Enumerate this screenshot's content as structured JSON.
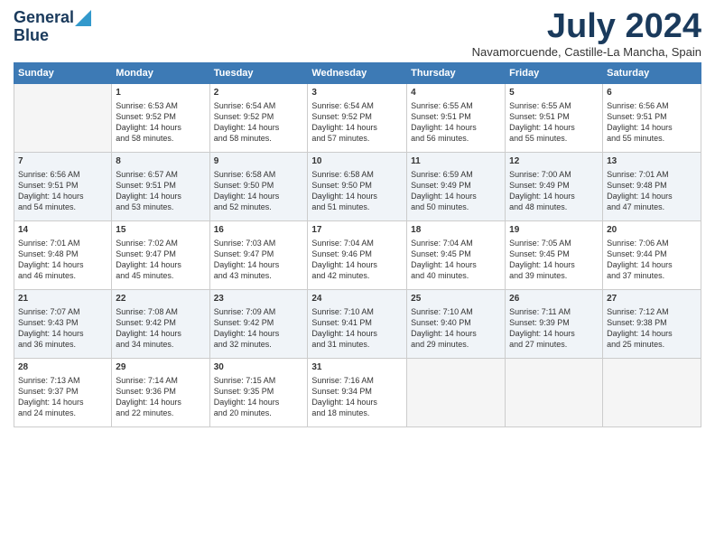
{
  "header": {
    "logo_general": "General",
    "logo_blue": "Blue",
    "month_title": "July 2024",
    "subtitle": "Navamorcuende, Castille-La Mancha, Spain"
  },
  "weekdays": [
    "Sunday",
    "Monday",
    "Tuesday",
    "Wednesday",
    "Thursday",
    "Friday",
    "Saturday"
  ],
  "weeks": [
    [
      {
        "day": null
      },
      {
        "day": 1,
        "sunrise": "6:53 AM",
        "sunset": "9:52 PM",
        "daylight": "14 hours and 58 minutes."
      },
      {
        "day": 2,
        "sunrise": "6:54 AM",
        "sunset": "9:52 PM",
        "daylight": "14 hours and 58 minutes."
      },
      {
        "day": 3,
        "sunrise": "6:54 AM",
        "sunset": "9:52 PM",
        "daylight": "14 hours and 57 minutes."
      },
      {
        "day": 4,
        "sunrise": "6:55 AM",
        "sunset": "9:51 PM",
        "daylight": "14 hours and 56 minutes."
      },
      {
        "day": 5,
        "sunrise": "6:55 AM",
        "sunset": "9:51 PM",
        "daylight": "14 hours and 55 minutes."
      },
      {
        "day": 6,
        "sunrise": "6:56 AM",
        "sunset": "9:51 PM",
        "daylight": "14 hours and 55 minutes."
      }
    ],
    [
      {
        "day": 7,
        "sunrise": "6:56 AM",
        "sunset": "9:51 PM",
        "daylight": "14 hours and 54 minutes."
      },
      {
        "day": 8,
        "sunrise": "6:57 AM",
        "sunset": "9:51 PM",
        "daylight": "14 hours and 53 minutes."
      },
      {
        "day": 9,
        "sunrise": "6:58 AM",
        "sunset": "9:50 PM",
        "daylight": "14 hours and 52 minutes."
      },
      {
        "day": 10,
        "sunrise": "6:58 AM",
        "sunset": "9:50 PM",
        "daylight": "14 hours and 51 minutes."
      },
      {
        "day": 11,
        "sunrise": "6:59 AM",
        "sunset": "9:49 PM",
        "daylight": "14 hours and 50 minutes."
      },
      {
        "day": 12,
        "sunrise": "7:00 AM",
        "sunset": "9:49 PM",
        "daylight": "14 hours and 48 minutes."
      },
      {
        "day": 13,
        "sunrise": "7:01 AM",
        "sunset": "9:48 PM",
        "daylight": "14 hours and 47 minutes."
      }
    ],
    [
      {
        "day": 14,
        "sunrise": "7:01 AM",
        "sunset": "9:48 PM",
        "daylight": "14 hours and 46 minutes."
      },
      {
        "day": 15,
        "sunrise": "7:02 AM",
        "sunset": "9:47 PM",
        "daylight": "14 hours and 45 minutes."
      },
      {
        "day": 16,
        "sunrise": "7:03 AM",
        "sunset": "9:47 PM",
        "daylight": "14 hours and 43 minutes."
      },
      {
        "day": 17,
        "sunrise": "7:04 AM",
        "sunset": "9:46 PM",
        "daylight": "14 hours and 42 minutes."
      },
      {
        "day": 18,
        "sunrise": "7:04 AM",
        "sunset": "9:45 PM",
        "daylight": "14 hours and 40 minutes."
      },
      {
        "day": 19,
        "sunrise": "7:05 AM",
        "sunset": "9:45 PM",
        "daylight": "14 hours and 39 minutes."
      },
      {
        "day": 20,
        "sunrise": "7:06 AM",
        "sunset": "9:44 PM",
        "daylight": "14 hours and 37 minutes."
      }
    ],
    [
      {
        "day": 21,
        "sunrise": "7:07 AM",
        "sunset": "9:43 PM",
        "daylight": "14 hours and 36 minutes."
      },
      {
        "day": 22,
        "sunrise": "7:08 AM",
        "sunset": "9:42 PM",
        "daylight": "14 hours and 34 minutes."
      },
      {
        "day": 23,
        "sunrise": "7:09 AM",
        "sunset": "9:42 PM",
        "daylight": "14 hours and 32 minutes."
      },
      {
        "day": 24,
        "sunrise": "7:10 AM",
        "sunset": "9:41 PM",
        "daylight": "14 hours and 31 minutes."
      },
      {
        "day": 25,
        "sunrise": "7:10 AM",
        "sunset": "9:40 PM",
        "daylight": "14 hours and 29 minutes."
      },
      {
        "day": 26,
        "sunrise": "7:11 AM",
        "sunset": "9:39 PM",
        "daylight": "14 hours and 27 minutes."
      },
      {
        "day": 27,
        "sunrise": "7:12 AM",
        "sunset": "9:38 PM",
        "daylight": "14 hours and 25 minutes."
      }
    ],
    [
      {
        "day": 28,
        "sunrise": "7:13 AM",
        "sunset": "9:37 PM",
        "daylight": "14 hours and 24 minutes."
      },
      {
        "day": 29,
        "sunrise": "7:14 AM",
        "sunset": "9:36 PM",
        "daylight": "14 hours and 22 minutes."
      },
      {
        "day": 30,
        "sunrise": "7:15 AM",
        "sunset": "9:35 PM",
        "daylight": "14 hours and 20 minutes."
      },
      {
        "day": 31,
        "sunrise": "7:16 AM",
        "sunset": "9:34 PM",
        "daylight": "14 hours and 18 minutes."
      },
      {
        "day": null
      },
      {
        "day": null
      },
      {
        "day": null
      }
    ]
  ]
}
